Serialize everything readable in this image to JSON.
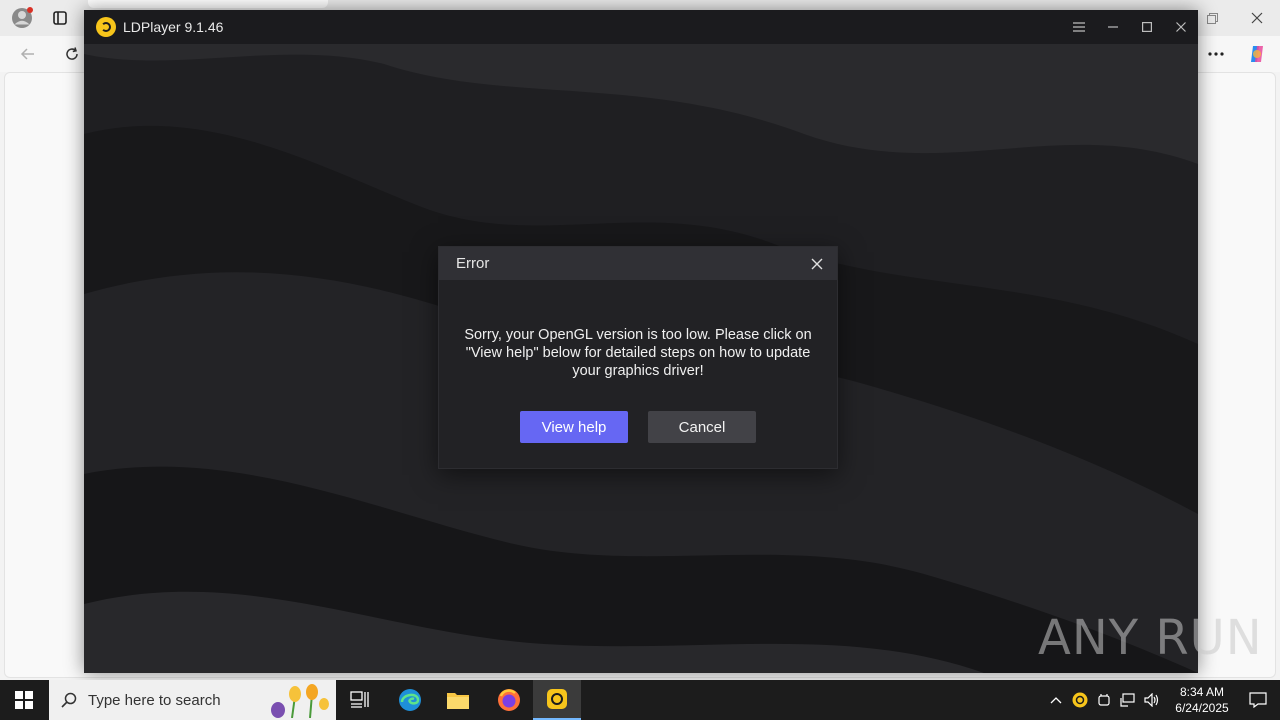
{
  "app": {
    "title": "LDPlayer 9.1.46"
  },
  "dialog": {
    "title": "Error",
    "message": "Sorry, your OpenGL version is too low. Please click on \"View help\" below for detailed steps on how to update your graphics driver!",
    "primary_label": "View help",
    "secondary_label": "Cancel"
  },
  "watermark": {
    "text": "ANY RUN"
  },
  "taskbar": {
    "search_placeholder": "Type here to search",
    "apps": [
      "task-view",
      "edge",
      "file-explorer",
      "firefox",
      "ldplayer"
    ],
    "clock_time": "8:34 AM",
    "clock_date": "6/24/2025"
  },
  "colors": {
    "accent": "#6667f3",
    "titlebar": "#1b1b1e",
    "dialog_bg": "#222225",
    "dialog_header": "#303035",
    "ld_logo": "#f7c51b"
  }
}
